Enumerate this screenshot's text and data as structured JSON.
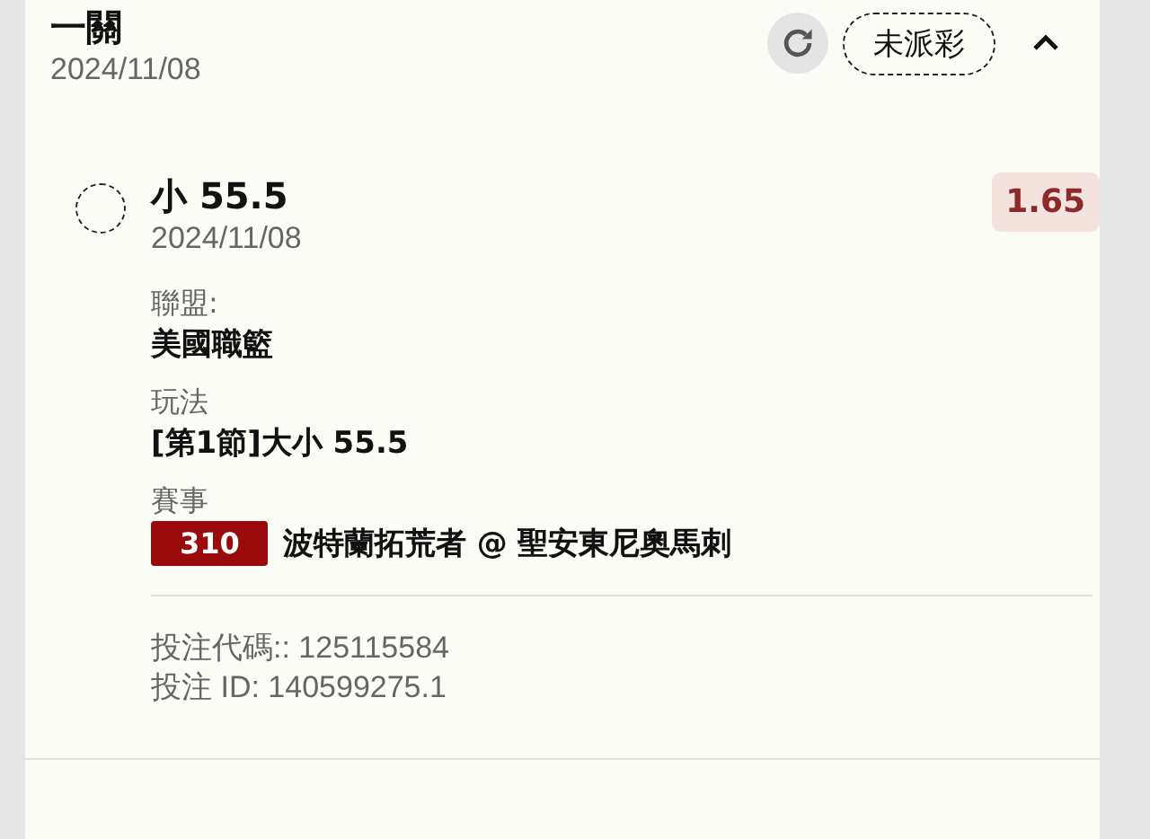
{
  "bet_card": {
    "title": "一關",
    "date": "2024/11/08",
    "status": "未派彩",
    "expanded": true,
    "selection": {
      "name": "小 55.5",
      "date": "2024/11/08",
      "odds": "1.65"
    },
    "details": [
      {
        "label": "聯盟:",
        "value": "美國職籃"
      },
      {
        "label": "玩法",
        "value": "[第1節]大小 55.5"
      },
      {
        "label": "賽事",
        "value": "波特蘭拓荒者 @ 聖安東尼奧馬刺",
        "badge": "310"
      }
    ],
    "footer": [
      "投注代碼:: 125115584",
      "投注 ID: 140599275.1"
    ]
  }
}
